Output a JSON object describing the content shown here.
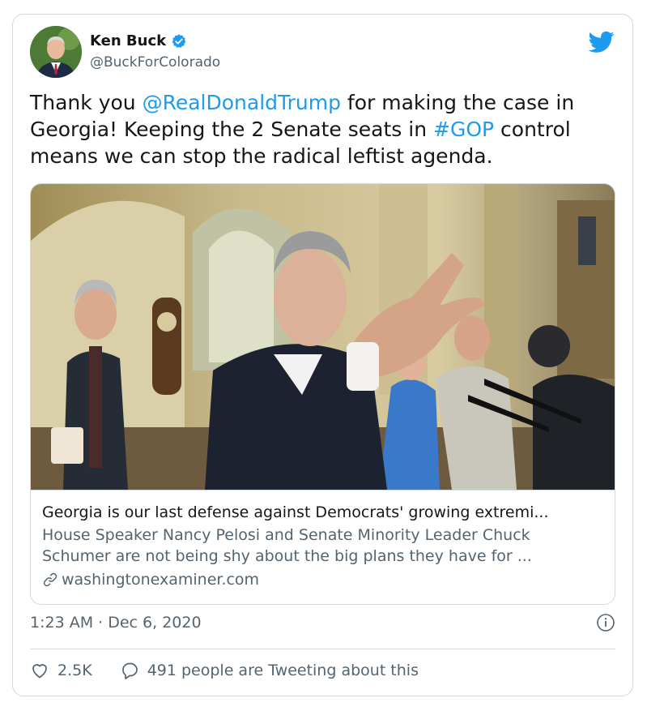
{
  "author": {
    "name": "Ken Buck",
    "handle": "@BuckForColorado"
  },
  "tweet": {
    "text_part1": "Thank you ",
    "mention": "@RealDonaldTrump",
    "text_part2": " for making the case in Georgia! Keeping the 2 Senate seats in ",
    "hashtag": "#GOP",
    "text_part3": " control means we can stop the radical leftist agenda."
  },
  "link_card": {
    "title": "Georgia is our last defense against Democrats' growing extremi...",
    "description": "House Speaker Nancy Pelosi and Senate Minority Leader Chuck Schumer are not being shy about the big plans they have for ...",
    "domain": "washingtonexaminer.com"
  },
  "meta": {
    "timestamp": "1:23 AM · Dec 6, 2020"
  },
  "actions": {
    "likes": "2.5K",
    "replies_text": "491 people are Tweeting about this"
  },
  "colors": {
    "accent": "#1d9bf0",
    "text": "#14171a",
    "secondary": "#536471",
    "border": "#cfd9de"
  },
  "icons": [
    "verified-icon",
    "twitter-bird-icon",
    "link-icon",
    "info-icon",
    "heart-icon",
    "reply-bubble-icon"
  ]
}
